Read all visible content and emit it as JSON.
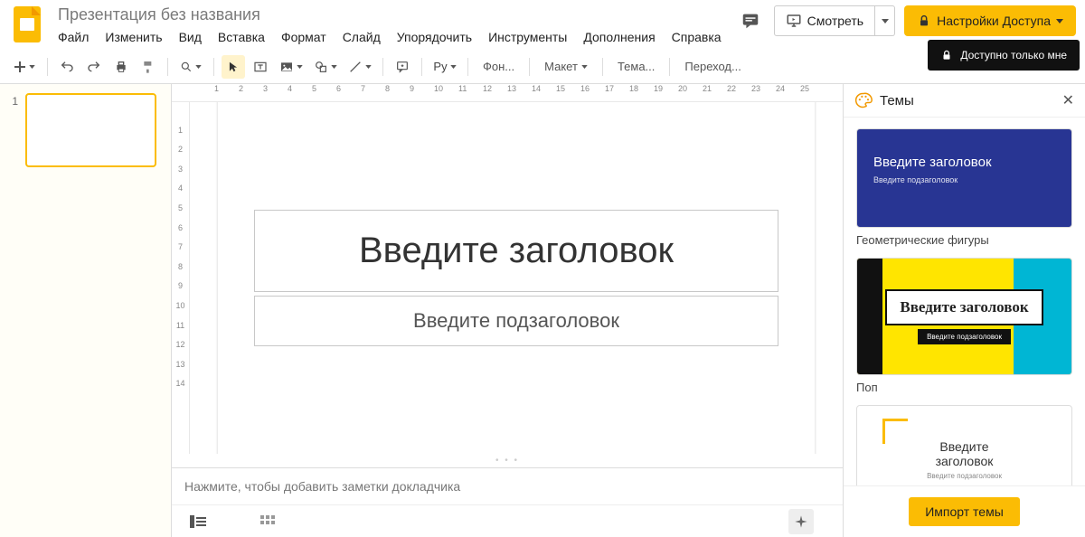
{
  "header": {
    "doc_title": "Презентация без названия",
    "menus": [
      "Файл",
      "Изменить",
      "Вид",
      "Вставка",
      "Формат",
      "Слайд",
      "Упорядочить",
      "Инструменты",
      "Дополнения",
      "Справка"
    ],
    "present_label": "Смотреть",
    "share_label": "Настройки Доступа",
    "tooltip": "Доступно только мне"
  },
  "toolbar": {
    "font_label": "Фон...",
    "layout_label": "Макет",
    "theme_label": "Тема...",
    "transition_label": "Переход...",
    "ru_label": "Ру"
  },
  "filmstrip": {
    "slides": [
      {
        "num": "1"
      }
    ]
  },
  "ruler_h": [
    "",
    "1",
    "2",
    "3",
    "4",
    "5",
    "6",
    "7",
    "8",
    "9",
    "10",
    "11",
    "12",
    "13",
    "14",
    "15",
    "16",
    "17",
    "18",
    "19",
    "20",
    "21",
    "22",
    "23",
    "24",
    "25"
  ],
  "ruler_v": [
    "",
    "1",
    "2",
    "3",
    "4",
    "5",
    "6",
    "7",
    "8",
    "9",
    "10",
    "11",
    "12",
    "13",
    "14"
  ],
  "slide": {
    "title_placeholder": "Введите заголовок",
    "subtitle_placeholder": "Введите подзаголовок"
  },
  "notes": {
    "placeholder": "Нажмите, чтобы добавить заметки докладчика"
  },
  "themes_panel": {
    "title": "Темы",
    "items": [
      {
        "preview_title": "Введите заголовок",
        "preview_sub": "Введите подзаголовок",
        "name": "Геометрические фигуры"
      },
      {
        "preview_title": "Введите заголовок",
        "preview_sub": "Введите подзаголовок",
        "name": "Поп"
      },
      {
        "preview_title": "Введите\nзаголовок",
        "preview_sub": "Введите подзаголовок",
        "name": ""
      }
    ],
    "import_label": "Импорт темы"
  },
  "colors": {
    "accent": "#fbbc04",
    "tooltip_bg": "#111111"
  }
}
